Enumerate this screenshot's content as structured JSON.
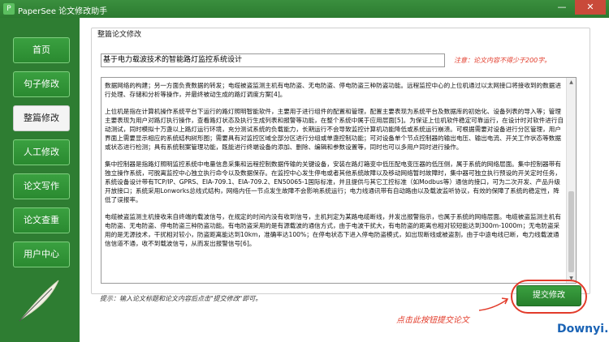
{
  "window": {
    "title": "PaperSee 论文修改助手",
    "logo_glyph": "P",
    "minimize_glyph": "—",
    "close_glyph": "✕"
  },
  "sidebar": {
    "items": [
      {
        "label": "首页"
      },
      {
        "label": "句子修改"
      },
      {
        "label": "整篇修改"
      },
      {
        "label": "人工修改"
      },
      {
        "label": "论文写作"
      },
      {
        "label": "论文查重"
      },
      {
        "label": "用户中心"
      }
    ],
    "active_index": 2
  },
  "main": {
    "section_title": "整篇论文修改",
    "title_value": "基于电力载波技术的智能路灯监控系统设计",
    "note": "注意：论文内容不得少于200字。",
    "paragraphs": [
      "数据网络的构建；另一方面负责数据的转发；电缆被盗监测主机有电防盗、无电防盗、停电防盗三种防盗功能。远程监控中心的上位机通过以太网接口将接收到的数据进行处理、存储和分析等操作，并最终被动生成的路灯调度方案[4]。",
      "上位机是指在计算机操作系统平台下运行的路灯照明智能软件，主要用于进行组件的配置和管理，配置主要表现为系统平台及数据库的初始化、设备列表的导入等；管理主要表现为用户对路灯执行操作，查看路灯状态及执行生成列表和报警等功能，在整个系统中属于应用层面[5]。为保证上位机软件稳定可靠运行，在设计时对软件进行自动测试，同时模拟十万盏以上路灯运行环境，充分测试系统的负载能力，长期运行不会导致监控计算机功能降低或系统运行崩溃。可根据需要对设备进行分区管理，用户界面上需要显示相应的系统结构树形图；需要具有对监控区域全部分区进行分组或单盏控制功能；可对设备单个节点控制器的输出电压、输出电流、开关工作状态等数据或状态进行检测；具有系统制案管理功能，既能进行终端设备的添加、删除、编辑和参数设置等，同时也可以多用户同时进行操作。",
      "集中控制器是指路灯照明监控系统中电量信息采集和远程控制数据传输的关键设备，安装在路灯箱变中低压配电变压器的低压侧，属于系统的网络层面。集中控制器带有独立操作系统，可脱离监控中心独立执行命令以及数据保存。在监控中心发生停电或者其他系统故障以及移动网络暂时故障时，集中器可独立执行预设的开关定时任务，系统设备设计带有TCP/IP、GPRS、EIA-709.1、EIA-709.2、EN50065-1国际标准，并且提供与其它工控标准（如Modbus等）通信的接口，可为二次开发、产品升级开放接口；系统采用Lonworks总线式结构，网络内任一节点发生故障不会影响系统运行；电力线通讯带有自动路由以及载波监听协议，有效的保障了系统的稳定性，降低了误报率。",
      "电缆被盗监测主机接收来自终端的载波信号，在规定的时间内没有收到信号，主机判定为某路电缆断线，并发出报警指示，也属于系统的网络层面。电缆被盗监测主机有电防盗、无电防盗、停电防盗三种防盗功能。有电防盗采用的是有源载波的通信方式，由于电波干扰大，有电防盗的距离也相对较短能达到300m-1000m；无电防盗采用的是无源技术，干扰相对较小，防盗距离能达到10km，准确率达100%；在停电状态下进入停电防盗模式，如出现断线或被盗割，由于中途电线已断，电力线载波通信信道不通，收不到载波信号，从而发出报警信号[6]。"
    ],
    "hint": "提示：输入论文标题和论文内容后点击\"提交修改\"即可。",
    "annotation": "点击此按钮提交论文",
    "submit_label": "提交修改",
    "watermark": "Downyi.com"
  },
  "colors": {
    "brand_green": "#2e7d32",
    "accent_red": "#e23b2a",
    "watermark_blue": "#1a63b5"
  }
}
